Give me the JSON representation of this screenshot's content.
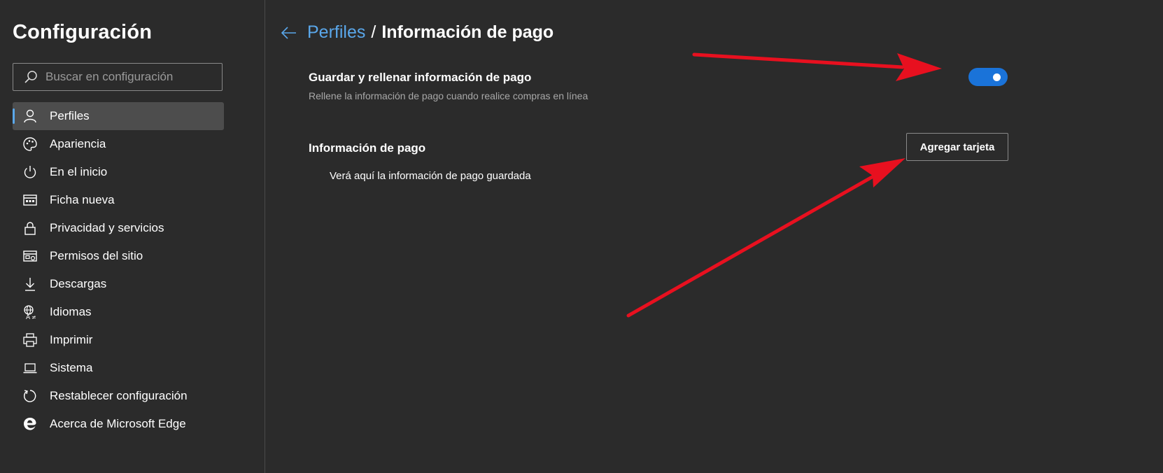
{
  "sidebar": {
    "title": "Configuración",
    "search": {
      "placeholder": "Buscar en configuración",
      "value": ""
    },
    "items": [
      {
        "id": "perfiles",
        "label": "Perfiles",
        "icon": "person-icon",
        "active": true
      },
      {
        "id": "apariencia",
        "label": "Apariencia",
        "icon": "palette-icon",
        "active": false
      },
      {
        "id": "inicio",
        "label": "En el inicio",
        "icon": "power-icon",
        "active": false
      },
      {
        "id": "ficha-nueva",
        "label": "Ficha nueva",
        "icon": "new-tab-icon",
        "active": false
      },
      {
        "id": "privacidad",
        "label": "Privacidad y servicios",
        "icon": "lock-icon",
        "active": false
      },
      {
        "id": "permisos",
        "label": "Permisos del sitio",
        "icon": "site-permissions-icon",
        "active": false
      },
      {
        "id": "descargas",
        "label": "Descargas",
        "icon": "download-icon",
        "active": false
      },
      {
        "id": "idiomas",
        "label": "Idiomas",
        "icon": "language-icon",
        "active": false
      },
      {
        "id": "imprimir",
        "label": "Imprimir",
        "icon": "printer-icon",
        "active": false
      },
      {
        "id": "sistema",
        "label": "Sistema",
        "icon": "laptop-icon",
        "active": false
      },
      {
        "id": "restablecer",
        "label": "Restablecer configuración",
        "icon": "reset-icon",
        "active": false
      },
      {
        "id": "acerca",
        "label": "Acerca de Microsoft Edge",
        "icon": "edge-logo-icon",
        "active": false
      }
    ]
  },
  "main": {
    "breadcrumb": {
      "parent": "Perfiles",
      "separator": "/",
      "current": "Información de pago"
    },
    "toggle_setting": {
      "title": "Guardar y rellenar información de pago",
      "description": "Rellene la información de pago cuando realice compras en línea",
      "enabled": true
    },
    "payment_section": {
      "title": "Información de pago",
      "add_button_label": "Agregar tarjeta",
      "empty_text": "Verá aquí la información de pago guardada"
    }
  },
  "colors": {
    "background": "#2b2b2b",
    "accent": "#5aa7ea",
    "toggle_on": "#1a73d9",
    "annotation_arrow": "#e8101f"
  }
}
